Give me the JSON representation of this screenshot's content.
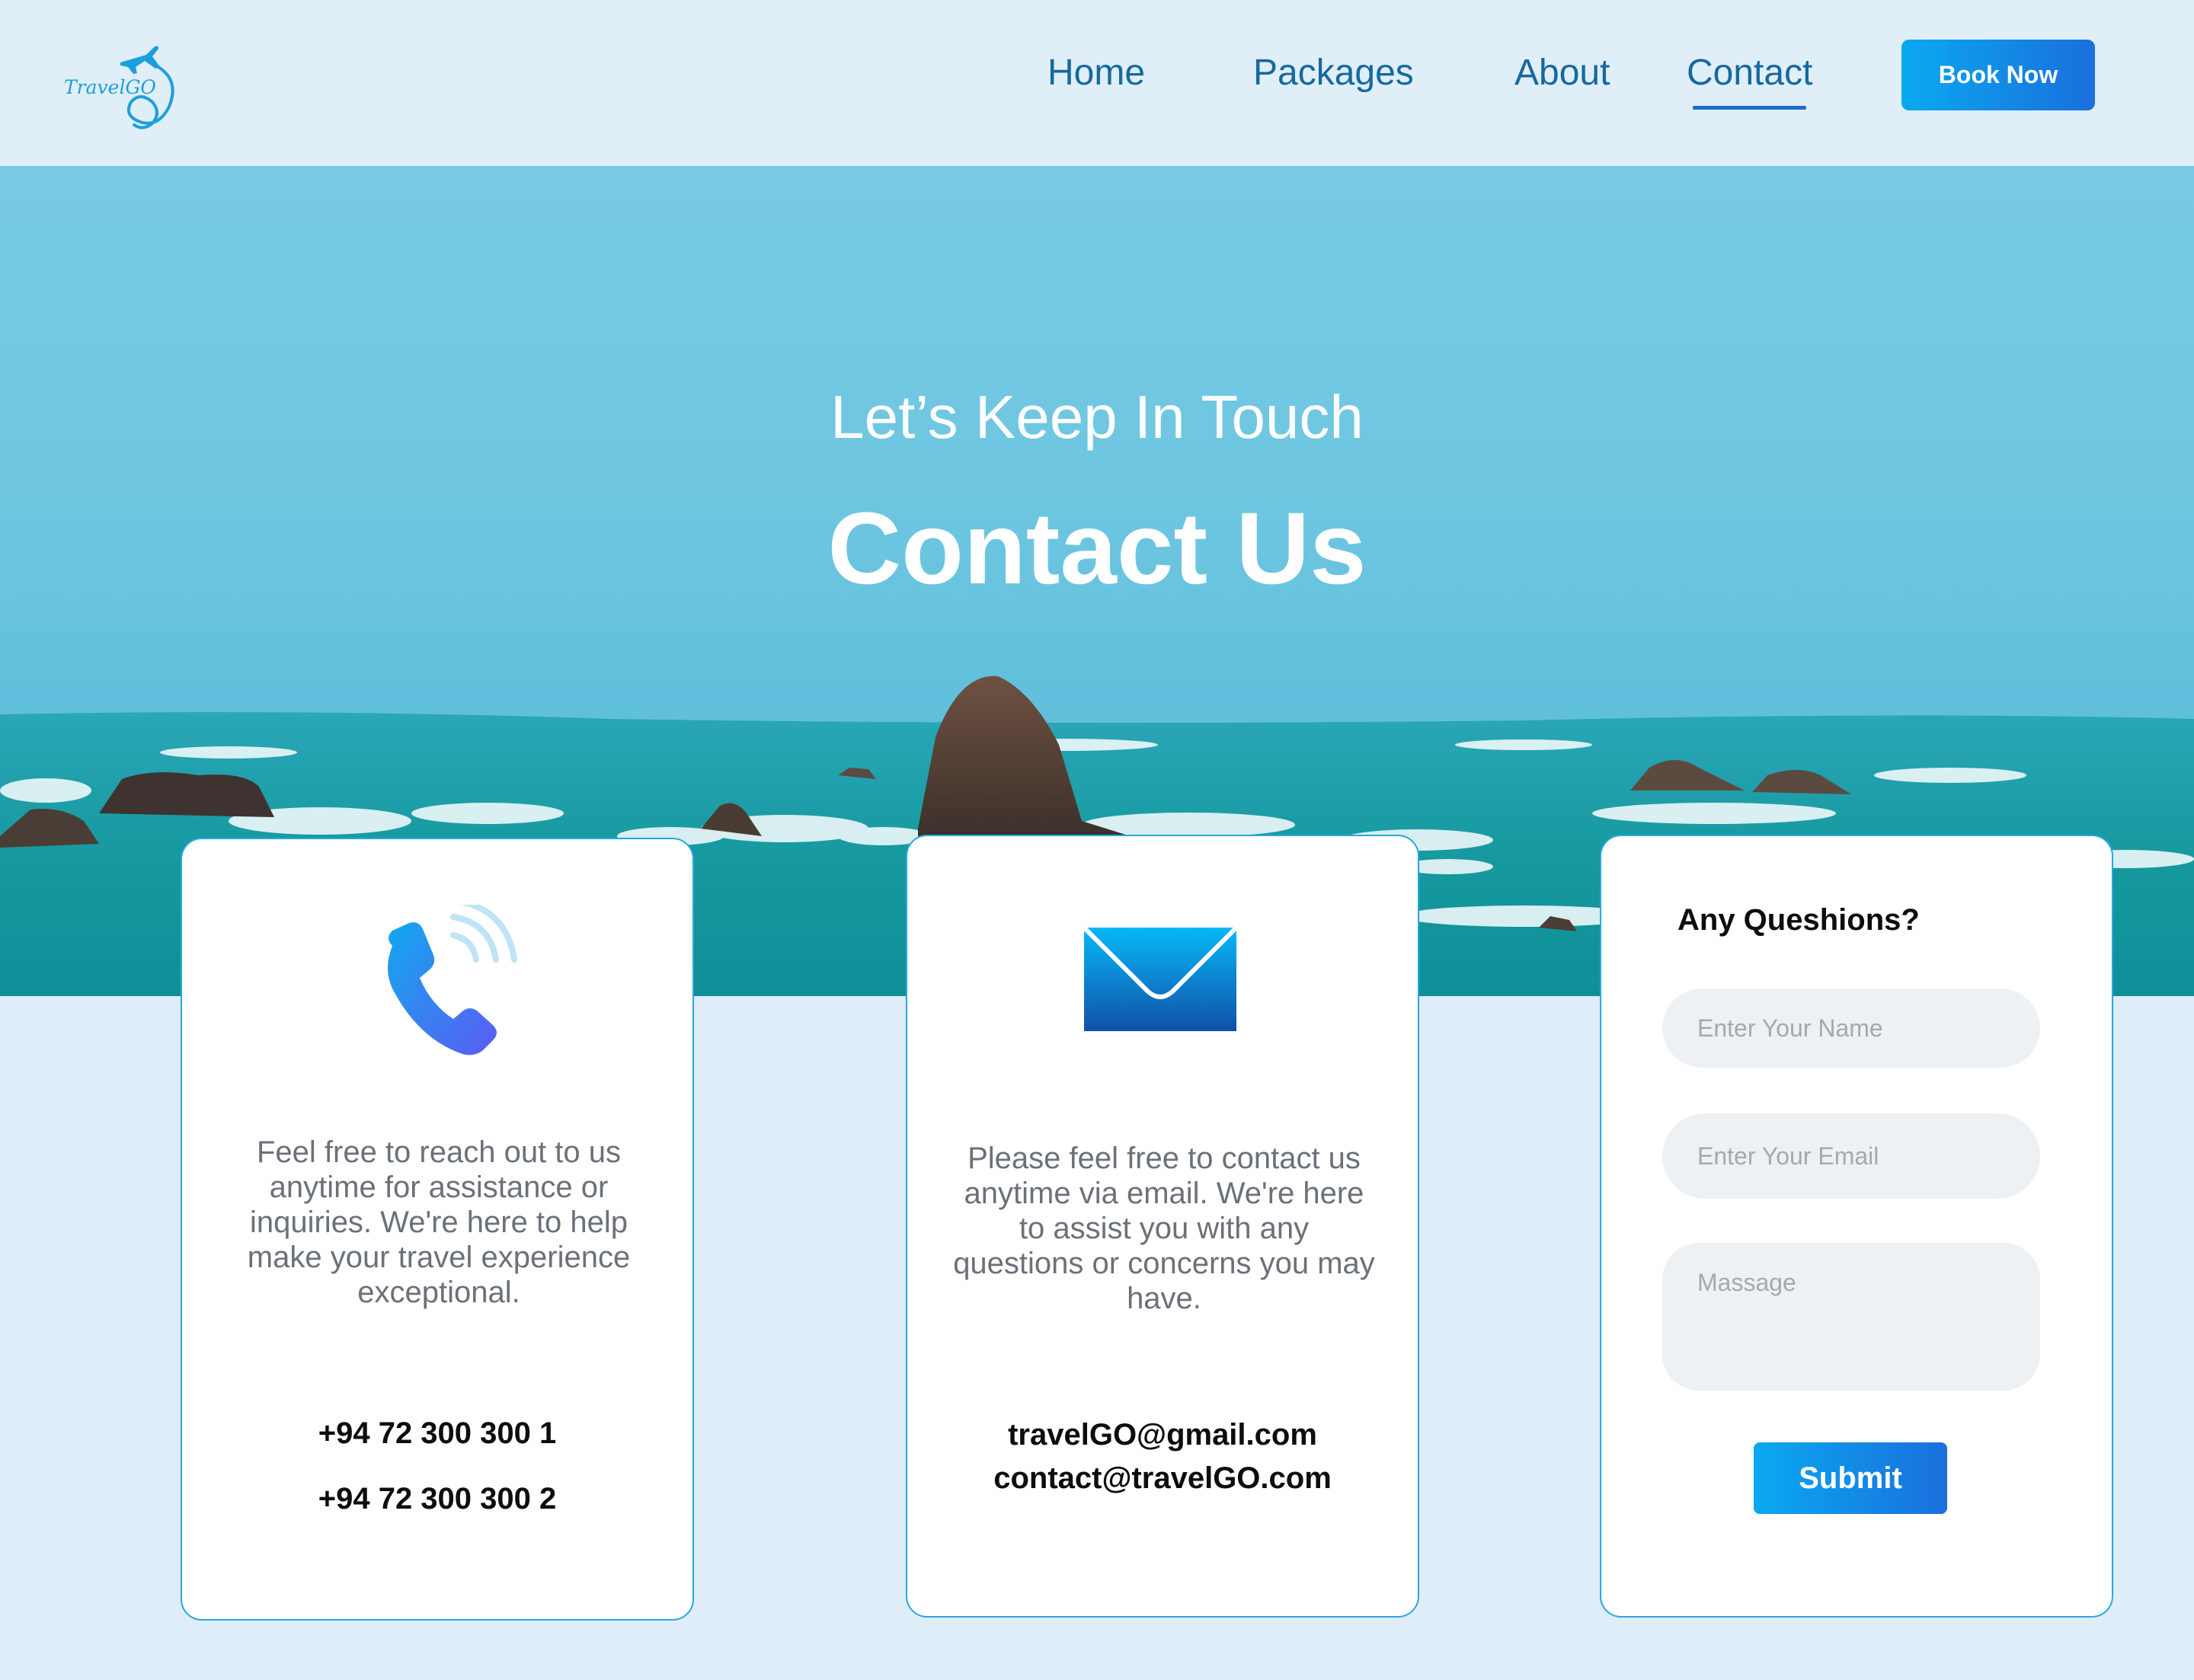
{
  "brand": {
    "logo_text": "TravelGO"
  },
  "nav": {
    "items": [
      {
        "label": "Home",
        "active": false
      },
      {
        "label": "Packages",
        "active": false
      },
      {
        "label": "About",
        "active": false
      },
      {
        "label": "Contact",
        "active": true
      }
    ],
    "cta_label": "Book Now"
  },
  "hero": {
    "subtitle": "Let’s Keep In Touch",
    "title": "Contact Us"
  },
  "phone_card": {
    "icon": "phone-icon",
    "text": "Feel free to reach out to us anytime for assistance or inquiries. We're here to help make your travel experience exceptional.",
    "numbers": [
      "+94 72 300 300 1",
      "+94 72 300 300 2"
    ]
  },
  "email_card": {
    "icon": "envelope-icon",
    "text": "Please feel free to contact us anytime via email. We're here to assist you with any questions or concerns you may have.",
    "emails": [
      "travelGO@gmail.com",
      "contact@travelGO.com"
    ]
  },
  "form": {
    "heading": "Any Queshions?",
    "name_placeholder": "Enter Your Name",
    "email_placeholder": "Enter Your Email",
    "message_placeholder": "Massage",
    "submit_label": "Submit"
  },
  "colors": {
    "page_background": "#deedf8",
    "nav_text": "#15699f",
    "accent_start": "#0aa9f1",
    "accent_end": "#1a6fdc",
    "card_border": "#25a9e0"
  }
}
